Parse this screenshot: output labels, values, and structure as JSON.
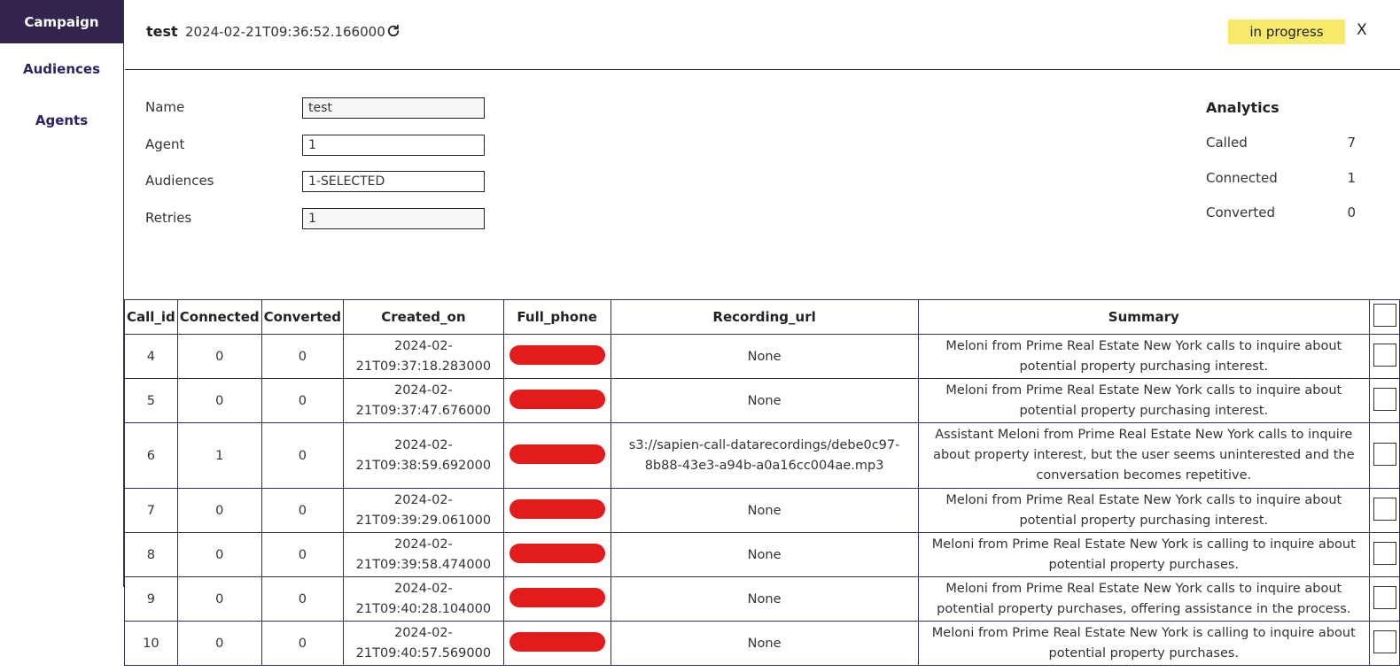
{
  "sidebar": {
    "items": [
      {
        "label": "Campaign",
        "active": true
      },
      {
        "label": "Audiences",
        "active": false
      },
      {
        "label": "Agents",
        "active": false
      }
    ]
  },
  "header": {
    "title": "test",
    "timestamp": "2024-02-21T09:36:52.166000",
    "refresh_icon": "refresh-icon",
    "status": "in progress",
    "status_color": "#f7ea6a",
    "close_label": "X"
  },
  "form": {
    "name_label": "Name",
    "name_value": "test",
    "agent_label": "Agent",
    "agent_value": "1",
    "audiences_label": "Audiences",
    "audiences_value": "1-SELECTED",
    "retries_label": "Retries",
    "retries_value": "1"
  },
  "analytics": {
    "title": "Analytics",
    "called_label": "Called",
    "called_value": "7",
    "connected_label": "Connected",
    "connected_value": "1",
    "converted_label": "Converted",
    "converted_value": "0"
  },
  "table": {
    "headers": [
      "Call_id",
      "Connected",
      "Converted",
      "Created_on",
      "Full_phone",
      "Recording_url",
      "Summary"
    ],
    "rows": [
      {
        "call_id": "4",
        "connected": "0",
        "converted": "0",
        "created_on": "2024-02-21T09:37:18.283000",
        "recording_url": "None",
        "summary": "Meloni from Prime Real Estate New York calls to inquire about potential property purchasing interest."
      },
      {
        "call_id": "5",
        "connected": "0",
        "converted": "0",
        "created_on": "2024-02-21T09:37:47.676000",
        "recording_url": "None",
        "summary": "Meloni from Prime Real Estate New York calls to inquire about potential property purchasing interest."
      },
      {
        "call_id": "6",
        "connected": "1",
        "converted": "0",
        "created_on": "2024-02-21T09:38:59.692000",
        "recording_url": "s3://sapien-call-datarecordings/debe0c97-8b88-43e3-a94b-a0a16cc004ae.mp3",
        "summary": "Assistant Meloni from Prime Real Estate New York calls to inquire about property interest, but the user seems uninterested and the conversation becomes repetitive."
      },
      {
        "call_id": "7",
        "connected": "0",
        "converted": "0",
        "created_on": "2024-02-21T09:39:29.061000",
        "recording_url": "None",
        "summary": "Meloni from Prime Real Estate New York calls to inquire about potential property purchasing interest."
      },
      {
        "call_id": "8",
        "connected": "0",
        "converted": "0",
        "created_on": "2024-02-21T09:39:58.474000",
        "recording_url": "None",
        "summary": "Meloni from Prime Real Estate New York is calling to inquire about potential property purchases."
      },
      {
        "call_id": "9",
        "connected": "0",
        "converted": "0",
        "created_on": "2024-02-21T09:40:28.104000",
        "recording_url": "None",
        "summary": "Meloni from Prime Real Estate New York calls to inquire about potential property purchases, offering assistance in the process."
      },
      {
        "call_id": "10",
        "connected": "0",
        "converted": "0",
        "created_on": "2024-02-21T09:40:57.569000",
        "recording_url": "None",
        "summary": "Meloni from Prime Real Estate New York is calling to inquire about potential property purchases."
      }
    ]
  }
}
